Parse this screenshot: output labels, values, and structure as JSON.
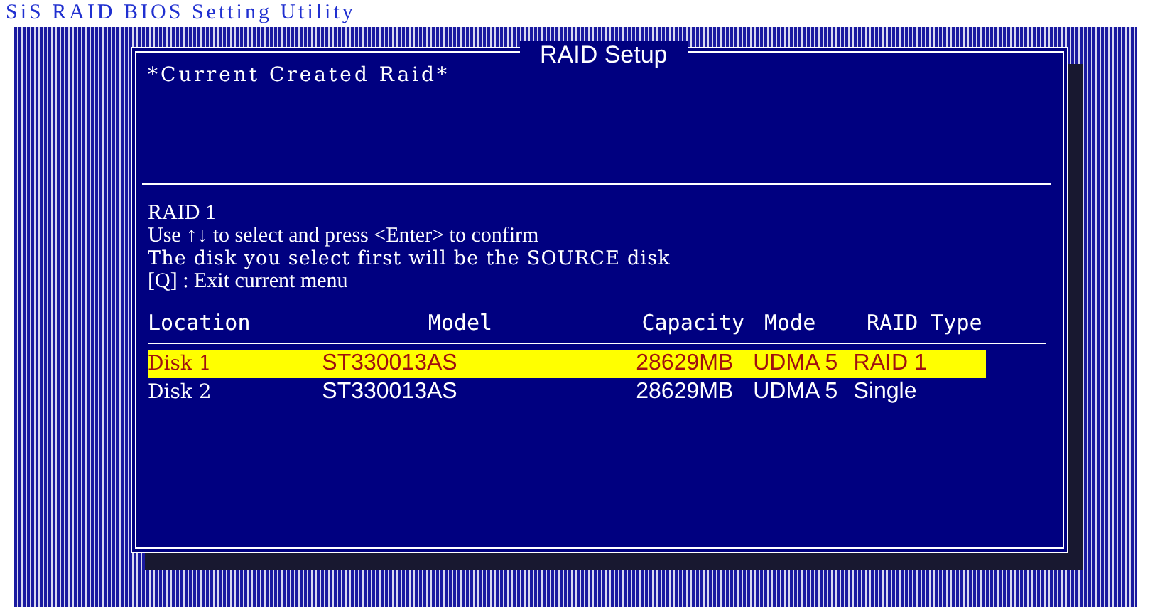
{
  "page_title": "SiS RAID BIOS Setting Utility",
  "dialog": {
    "title": "RAID Setup",
    "section_heading": "*Current Created Raid*",
    "raid_level": "RAID 1",
    "instructions": [
      "Use ↑↓ to select and press <Enter> to confirm",
      "The disk you select first will be the SOURCE disk",
      "[Q] : Exit current menu"
    ]
  },
  "table": {
    "columns": [
      "Location",
      "Model",
      "Capacity",
      "Mode",
      "RAID Type"
    ],
    "rows": [
      {
        "cells": [
          "Disk 1",
          "ST330013AS",
          "28629MB",
          "UDMA 5",
          "RAID 1"
        ],
        "selected": true
      },
      {
        "cells": [
          "Disk 2",
          "ST330013AS",
          "28629MB",
          "UDMA 5",
          "Single"
        ],
        "selected": false
      }
    ]
  }
}
